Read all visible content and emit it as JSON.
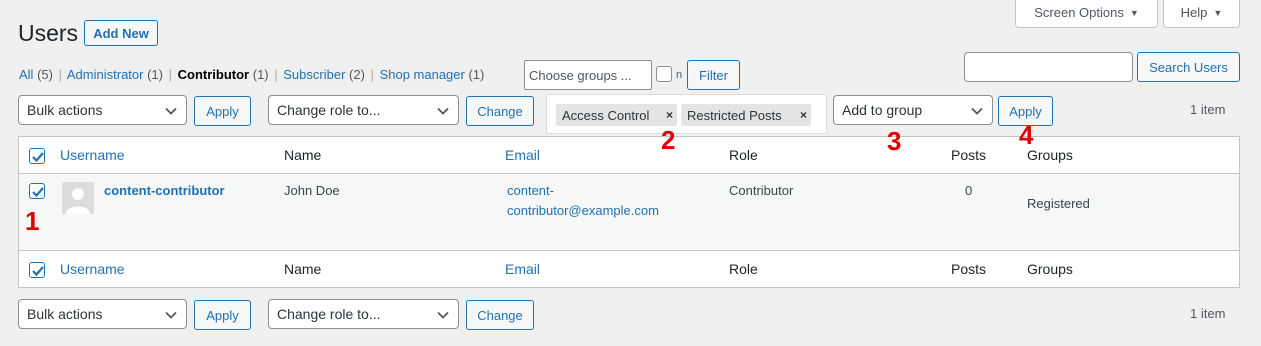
{
  "header": {
    "title": "Users",
    "add_new_label": "Add New",
    "screen_options_label": "Screen Options",
    "help_label": "Help"
  },
  "filters": {
    "views": [
      {
        "label": "All",
        "count": "(5)",
        "current": false
      },
      {
        "label": "Administrator",
        "count": "(1)",
        "current": false
      },
      {
        "label": "Contributor",
        "count": "(1)",
        "current": true
      },
      {
        "label": "Subscriber",
        "count": "(2)",
        "current": false
      },
      {
        "label": "Shop manager",
        "count": "(1)",
        "current": false
      }
    ],
    "separator": "|",
    "choose_groups_placeholder": "Choose groups ...",
    "checkbox_label": "n",
    "filter_label": "Filter"
  },
  "search": {
    "value": "",
    "button_label": "Search Users"
  },
  "top_actions": {
    "bulk_actions_value": "Bulk actions",
    "apply_label": "Apply",
    "change_role_value": "Change role to...",
    "change_label": "Change",
    "group_tags": [
      {
        "label": "Access Control",
        "remove": "×"
      },
      {
        "label": "Restricted Posts",
        "remove": "×"
      }
    ],
    "add_to_group_value": "Add to group",
    "group_apply_label": "Apply",
    "items_count": "1 item"
  },
  "table": {
    "columns": {
      "username": "Username",
      "name": "Name",
      "email": "Email",
      "role": "Role",
      "posts": "Posts",
      "groups": "Groups"
    },
    "rows": [
      {
        "checked": true,
        "username": "content-contributor",
        "name": "John Doe",
        "email_line1": "content-",
        "email_line2": "contributor@example.com",
        "role": "Contributor",
        "posts": "0",
        "groups": "Registered"
      }
    ]
  },
  "bottom_actions": {
    "bulk_actions_value": "Bulk actions",
    "apply_label": "Apply",
    "change_role_value": "Change role to...",
    "change_label": "Change",
    "items_count": "1 item"
  },
  "annotations": [
    "1",
    "2",
    "3",
    "4"
  ],
  "colors": {
    "accent": "#2271b1",
    "annotation": "#e10000",
    "background": "#f0f0f1"
  }
}
